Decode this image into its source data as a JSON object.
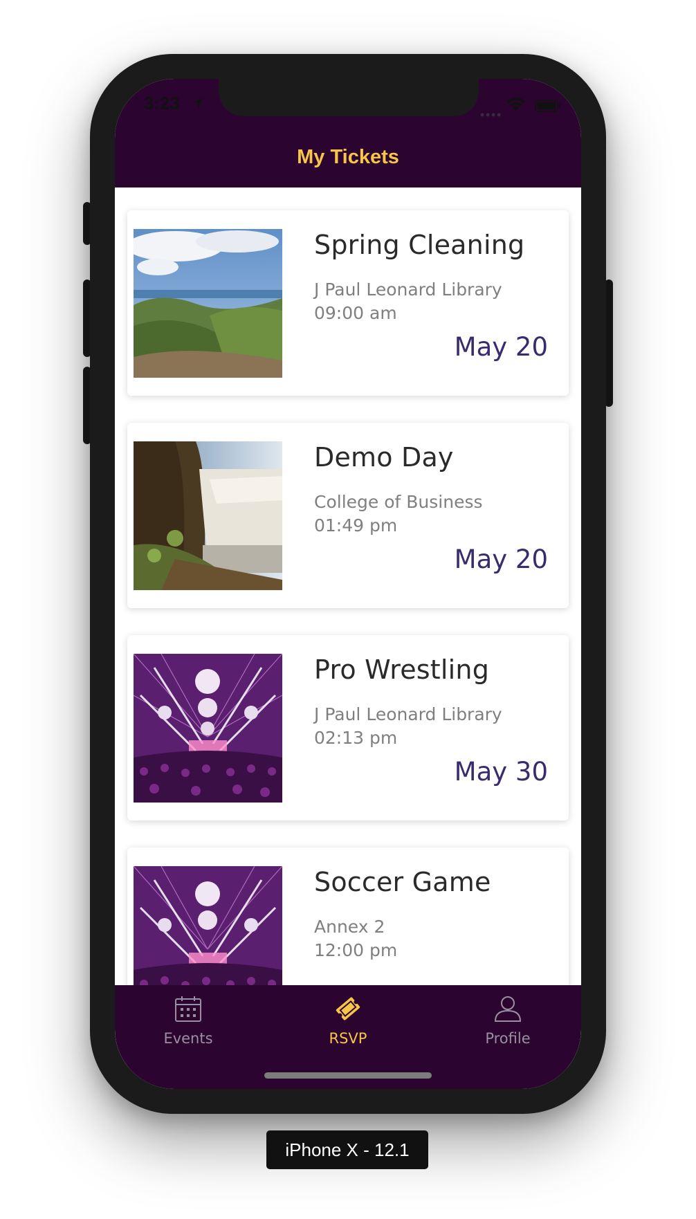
{
  "status_bar": {
    "time": "3:23"
  },
  "nav": {
    "title": "My Tickets"
  },
  "events": [
    {
      "title": "Spring Cleaning",
      "venue": "J Paul Leonard Library",
      "time": "09:00 am",
      "date": "May 20",
      "image": "coastal-hills-photo"
    },
    {
      "title": "Demo Day",
      "venue": "College of Business",
      "time": "01:49 pm",
      "date": "May 20",
      "image": "waterfall-photo"
    },
    {
      "title": "Pro Wrestling",
      "venue": "J Paul Leonard Library",
      "time": "02:13 pm",
      "date": "May 30",
      "image": "concert-lights-photo"
    },
    {
      "title": "Soccer Game",
      "venue": "Annex 2",
      "time": "12:00 pm",
      "date": "",
      "image": "concert-lights-photo"
    }
  ],
  "tabs": [
    {
      "label": "Events",
      "icon": "calendar-icon",
      "active": false
    },
    {
      "label": "RSVP",
      "icon": "ticket-icon",
      "active": true
    },
    {
      "label": "Profile",
      "icon": "person-icon",
      "active": false
    }
  ],
  "device_caption": "iPhone X - 12.1",
  "colors": {
    "nav_bg": "#2b0530",
    "accent": "#f7c548",
    "date": "#3a2a6e",
    "inactive_tab": "#9a8fa0"
  }
}
